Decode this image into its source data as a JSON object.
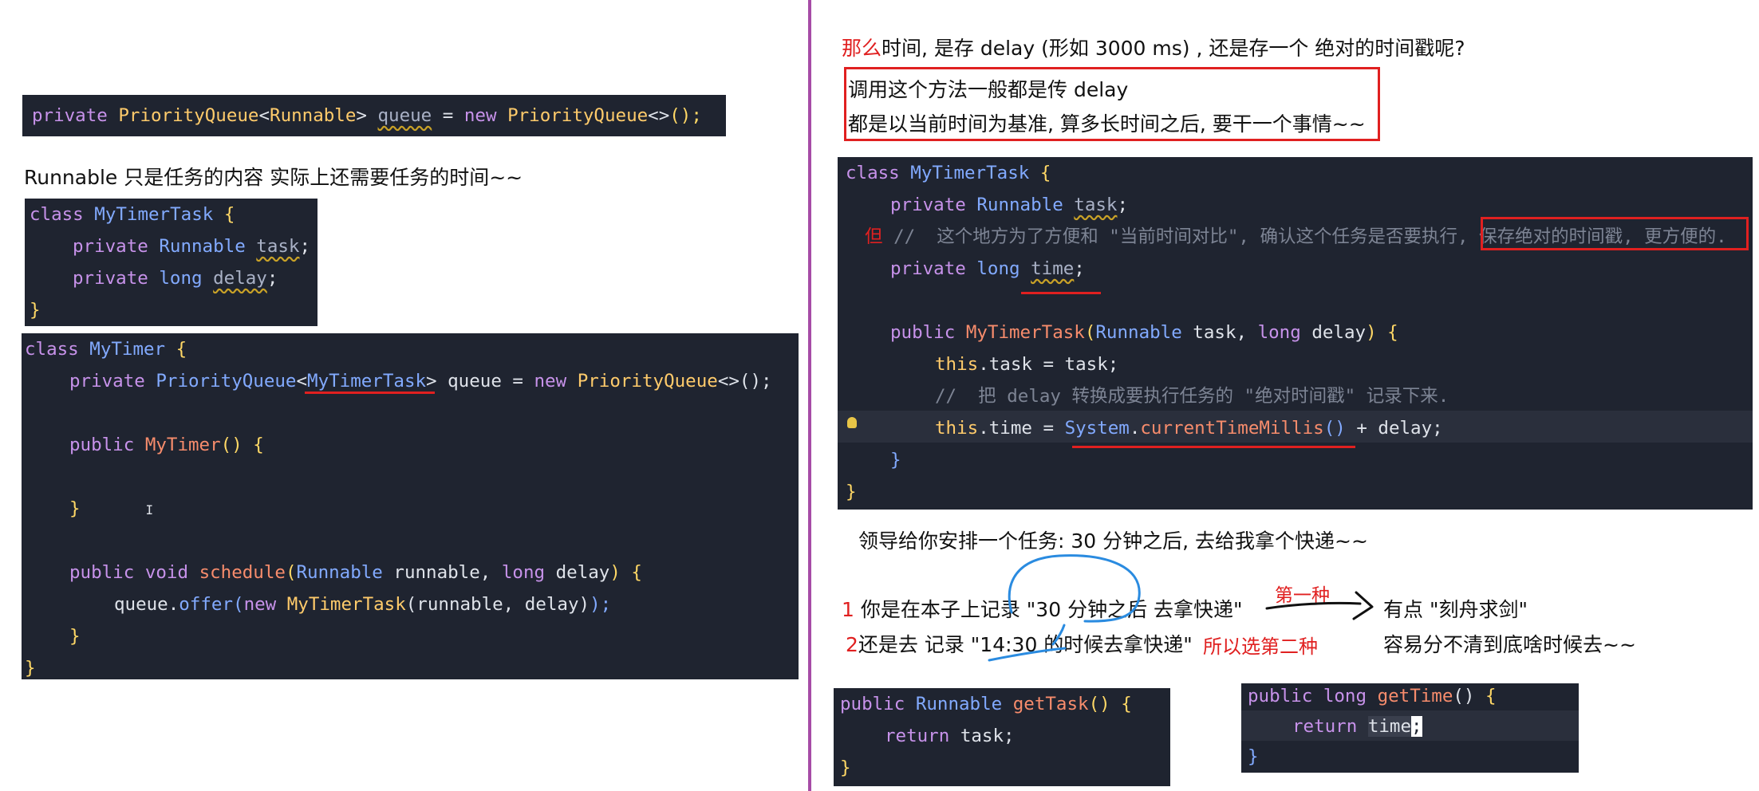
{
  "left": {
    "code_queue": {
      "private": "private",
      "type": "PriorityQueue",
      "lt": "<",
      "gen": "Runnable",
      "gt": ">",
      "var": "queue",
      "eq": " = ",
      "new": "new",
      "ctor": "PriorityQueue",
      "diamond": "<>",
      "tail": "();"
    },
    "note_runnable": "Runnable 只是任务的内容   实际上还需要任务的时间~~",
    "code_task": {
      "class_kw": "class",
      "class_name": "MyTimerTask",
      "brace_open": "{",
      "private": "private",
      "runnable": "Runnable",
      "task": "task",
      "semi": ";",
      "long": "long",
      "delay": "delay",
      "brace_close": "}"
    },
    "code_timer": {
      "class_kw": "class",
      "class_name": "MyTimer",
      "brace_open": "{",
      "line1": {
        "private": "private",
        "type": "PriorityQueue",
        "lt": "<",
        "gen": "MyTimerTask",
        "gt": ">",
        "rest": " queue = ",
        "new": "new",
        "ctor": "PriorityQueue",
        "tail": "<>();"
      },
      "line3": {
        "public": "public",
        "name": "MyTimer",
        "rest": "() {"
      },
      "line5": "}",
      "line7": {
        "public": "public",
        "void": "void",
        "name": "schedule",
        "open": "(",
        "type1": "Runnable",
        "arg1": " runnable, ",
        "type2": "long",
        "arg2": " delay",
        "close": ") {"
      },
      "line8": {
        "queue": "queue.",
        "offer": "offer",
        "open": "(",
        "new": "new",
        "ctor": "MyTimerTask",
        "args": "(runnable, delay)",
        "tail": ");"
      },
      "line9": "}",
      "line10": "}"
    }
  },
  "right": {
    "question_prefix": "那么",
    "question": "时间, 是存 delay (形如 3000 ms) , 还是存一个 绝对的时间戳呢?",
    "answer_line1": "调用这个方法一般都是传 delay",
    "answer_line2": "都是以当前时间为基准, 算多长时间之后, 要干一个事情~~",
    "code_main": {
      "l1": {
        "class_kw": "class",
        "name": "MyTimerTask",
        "brace": "{"
      },
      "l2": {
        "private": "private",
        "type": "Runnable",
        "field": "task",
        "semi": ";"
      },
      "l3_mark": "但",
      "l3_comment": "//  这个地方为了方便和 \"当前时间对比\", 确认这个任务是否要执行, ",
      "l3_boxed": "保存绝对的时间戳, 更方便的.",
      "l4": {
        "private": "private",
        "type": "long",
        "field": "time",
        "semi": ";"
      },
      "l6": {
        "public": "public",
        "name": "MyTimerTask",
        "open": "(",
        "t1": "Runnable",
        "a1": " task, ",
        "t2": "long",
        "a2": " delay",
        "close": ")",
        "brace": " {"
      },
      "l7": {
        "this": "this",
        "rest": ".task = task;"
      },
      "l8": "//  把 delay 转换成要执行任务的 \"绝对时间戳\" 记录下来.",
      "l9": {
        "this": "this",
        "rest1": ".time = ",
        "system": "System",
        "dot": ".",
        "call": "currentTimeMillis",
        "parens": "()",
        "rest2": " + delay;"
      },
      "l10": "}",
      "l11": "}"
    },
    "leader_note": "领导给你安排一个任务: 30 分钟之后, 去给我拿个快递~~",
    "opt1_num": "1",
    "opt1": "你是在本子上记录 \"30 分钟之后 去拿快递\"",
    "opt2_num": "2",
    "opt2": "还是去 记录 \"14:30 的时候去拿快递\"",
    "first_kind": "第一种",
    "so_second": "所以选第二种",
    "idiom": "有点 \"刻舟求剑\"",
    "confusing": "容易分不清到底啥时候去~~",
    "code_get_task": {
      "public": "public",
      "type": "Runnable",
      "name": "getTask",
      "rest": "() {",
      "ret": "return",
      "val": " task;",
      "close": "}"
    },
    "code_get_time": {
      "public": "public",
      "type": "long",
      "name": "getTime",
      "rest": "() ",
      "brace": "{",
      "ret": "return",
      "val": "time",
      "semi": ";",
      "close": "}"
    }
  },
  "colors": {
    "keyword": "#c792ea",
    "type": "#82aaff",
    "class": "#ffcb6b",
    "method": "#f78c6c",
    "annotation": "#e02020",
    "ink": "#2a8be0",
    "divider": "#a64ca6"
  }
}
